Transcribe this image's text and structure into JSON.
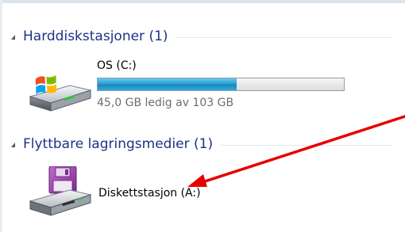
{
  "groups": [
    {
      "title": "Harddiskstasjoner (1)",
      "drives": [
        {
          "name": "OS (C:)",
          "free_text": "45,0 GB ledig av 103 GB",
          "used_fraction": 0.564
        }
      ]
    },
    {
      "title": "Flyttbare lagringsmedier (1)",
      "drives": [
        {
          "name": "Diskettstasjon (A:)"
        }
      ]
    }
  ],
  "icons": {
    "hard_drive": "hard-drive-windows-icon",
    "floppy_drive": "floppy-drive-icon",
    "collapse": "collapse-triangle-icon"
  },
  "colors": {
    "group_title": "#1e3287",
    "bar_fill": "#26a0da",
    "annotation_arrow": "#e60000"
  }
}
